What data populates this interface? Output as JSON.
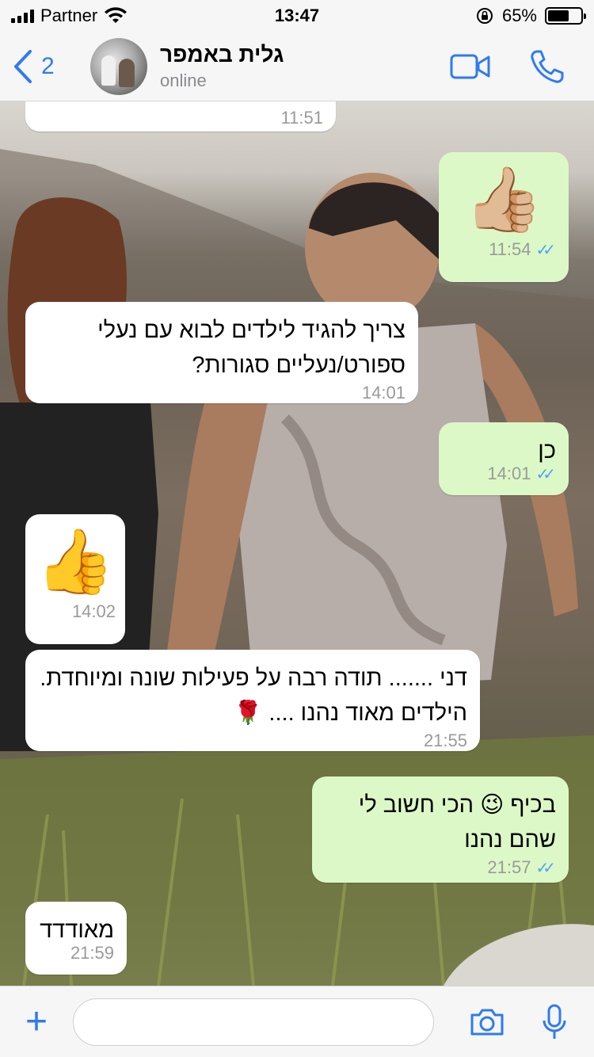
{
  "status_bar": {
    "carrier": "Partner",
    "time": "13:47",
    "battery": "65%",
    "battery_level": 0.65
  },
  "header": {
    "back_count": "2",
    "contact_name": "גלית באמפר",
    "contact_status": "online"
  },
  "messages": [
    {
      "direction": "in",
      "text": "",
      "time": "11:51"
    },
    {
      "direction": "out",
      "emoji": "👍🏼",
      "time": "11:54",
      "read": true
    },
    {
      "direction": "in",
      "text": "צריך להגיד לילדים לבוא עם נעלי ספורט/נעליים סגורות?",
      "time": "14:01"
    },
    {
      "direction": "out",
      "text": "כן",
      "time": "14:01",
      "read": true
    },
    {
      "direction": "in",
      "emoji": "👍",
      "time": "14:02"
    },
    {
      "direction": "in",
      "text": "דני ....... תודה רבה על פעילות שונה ומיוחדת. הילדים מאוד נהנו .... 🌹",
      "time": "21:55"
    },
    {
      "direction": "out",
      "text": "בכיף 😉 הכי חשוב לי שהם נהנו",
      "time": "21:57",
      "read": true
    },
    {
      "direction": "in",
      "text": "מאודדד",
      "time": "21:59"
    }
  ],
  "composer": {
    "placeholder": ""
  },
  "colors": {
    "accent": "#2f7bf0",
    "outgoing_bubble": "#dcf8c6",
    "incoming_bubble": "#ffffff",
    "read_ticks": "#4fa3f7"
  },
  "icons": {
    "back": "chevron-left-icon",
    "video": "video-camera-icon",
    "call": "phone-icon",
    "attach": "plus-icon",
    "camera": "camera-icon",
    "mic": "microphone-icon"
  }
}
